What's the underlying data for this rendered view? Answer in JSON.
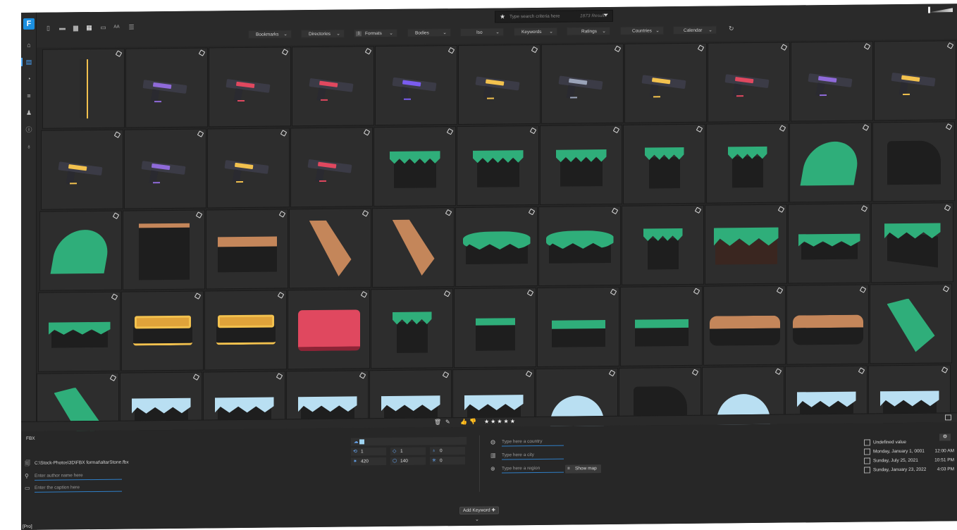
{
  "search": {
    "placeholder": "Type search criteria here",
    "results": "1873 Results"
  },
  "filters": [
    {
      "label": "Bookmarks",
      "badge": ""
    },
    {
      "label": "Directories",
      "badge": ""
    },
    {
      "label": "Formats",
      "badge": "1"
    },
    {
      "label": "Bodies",
      "badge": ""
    },
    {
      "label": "Iso",
      "badge": ""
    },
    {
      "label": "Keywords",
      "badge": ""
    },
    {
      "label": "Ratings",
      "badge": ""
    },
    {
      "label": "Countries",
      "badge": ""
    },
    {
      "label": "Calendar",
      "badge": ""
    }
  ],
  "nav_icons": [
    "home-icon",
    "library-icon",
    "stats-icon",
    "sliders-icon",
    "person-icon",
    "info-icon",
    "lightbulb-icon"
  ],
  "view_buttons": [
    "file-view-icon",
    "single-view-icon",
    "preview-view-icon",
    "grid-view-icon",
    "slideshow-icon",
    "font-size-icon",
    "list-view-icon"
  ],
  "grid": {
    "rows": [
      [
        "gun-tall",
        "gun-purple",
        "gun-pink",
        "gun-red",
        "gun-violet",
        "gun-gold",
        "gun-long",
        "gun-gold",
        "gun-pink",
        "gun-purple",
        "gun-gold"
      ],
      [
        "gun-yellow",
        "gun-purple",
        "gun-gold",
        "gun-red",
        "grass-block",
        "grass-block",
        "grass-block",
        "grass-pillar",
        "grass-pillar",
        "grass-arch",
        "dark-arch"
      ],
      [
        "grass-arch",
        "dark-cube",
        "dirt-slab",
        "dirt-ramp",
        "dirt-ramp",
        "grass-mound",
        "grass-mound",
        "grass-pillar",
        "grass-dirt",
        "grass-slab",
        "grass-corner"
      ],
      [
        "grass-slab",
        "gold-altar",
        "gold-altar",
        "red-altar",
        "grass-pillar",
        "green-cube",
        "green-slab",
        "green-slab",
        "dirt-slab-round",
        "dirt-slab-round",
        "grass-wedge"
      ],
      [
        "grass-wedge",
        "ice-block",
        "ice-block",
        "ice-block",
        "ice-block",
        "ice-block",
        "ice-arch",
        "dark-arch",
        "ice-arch",
        "ice-block",
        "ice-block"
      ]
    ]
  },
  "toolbar_row": {
    "stars": "★★★★★"
  },
  "detail": {
    "format": "FBX",
    "path": "C:\\Stock-Photos\\3D\\FBX format\\altarStone.fbx",
    "author_placeholder": "Enter author name here",
    "caption_placeholder": "Enter the caption here",
    "stats": [
      {
        "icon": "cycle-icon",
        "value": "1"
      },
      {
        "icon": "diamond-icon",
        "value": "1"
      },
      {
        "icon": "bulb-icon",
        "value": "0"
      },
      {
        "icon": "vertices-icon",
        "value": "420"
      },
      {
        "icon": "polygons-icon",
        "value": "140"
      },
      {
        "icon": "joints-icon",
        "value": "0"
      }
    ],
    "country_placeholder": "Type here a country",
    "city_placeholder": "Type here a city",
    "region_placeholder": "Type here a region",
    "show_map": "Show map",
    "dates": [
      {
        "date": "Undefined value",
        "time": ""
      },
      {
        "date": "Monday, January 1, 0001",
        "time": "12:00 AM"
      },
      {
        "date": "Sunday, July 25, 2021",
        "time": "10:51 PM"
      },
      {
        "date": "Sunday, January 23, 2022",
        "time": "4:03 PM"
      }
    ],
    "add_keyword": "Add Keyword ✚"
  },
  "status": {
    "edition": "[Pro]"
  },
  "colors": {
    "accent": "#2f7ec6",
    "grass": "#2fae7a",
    "dirt": "#c4865a",
    "gold": "#f2c14e",
    "red": "#e0485f",
    "ice": "#b9dff2"
  }
}
